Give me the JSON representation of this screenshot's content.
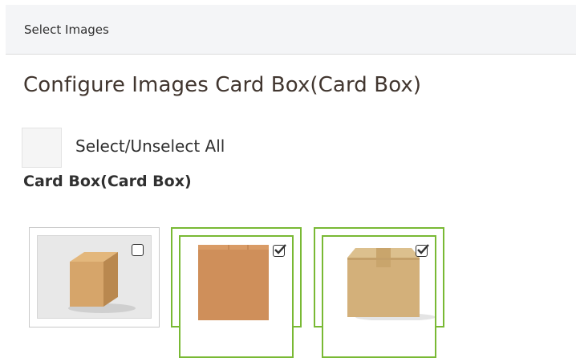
{
  "header": {
    "title": "Select Images"
  },
  "page": {
    "title": "Configure Images Card Box(Card Box)"
  },
  "select_all": {
    "label": "Select/Unselect All",
    "checked": false
  },
  "group": {
    "label": "Card Box(Card Box)"
  },
  "images": [
    {
      "name": "closed-cube-box",
      "checked": false
    },
    {
      "name": "flat-box-front",
      "checked": true
    },
    {
      "name": "taped-box",
      "checked": true
    }
  ],
  "colors": {
    "selected_border": "#79b934",
    "header_bg": "#f4f5f7"
  }
}
